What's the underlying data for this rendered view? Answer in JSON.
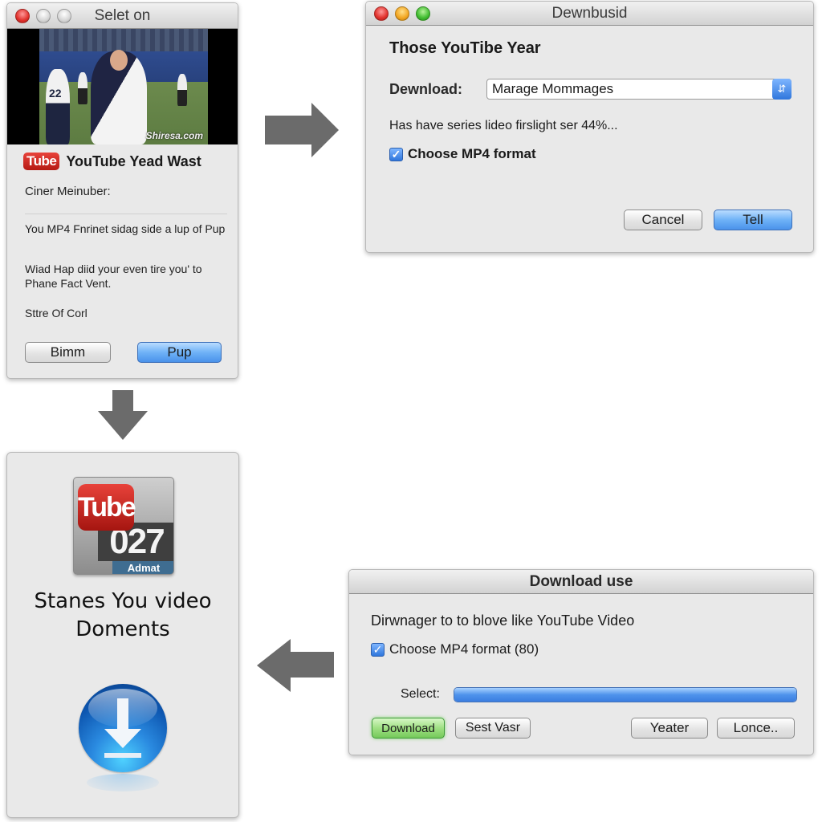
{
  "window1": {
    "title": "Selet on",
    "video": {
      "watermark": "Shiresa.com",
      "jersey_number": "22"
    },
    "badge": "Tube",
    "heading": "YouTube Yead Wast",
    "subtitle": "Ciner Meinuber:",
    "paragraph1": "You MP4 Fnrinet sidag side a lup of Pup",
    "paragraph2": "Wiad Hap diid your even tire you' to Phane Fact Vent.",
    "paragraph3": "Sttre Of Corl",
    "buttons": {
      "secondary": "Bimm",
      "primary": "Pup"
    }
  },
  "window2": {
    "title": "Dewnbusid",
    "heading": "Those YouTibe Year",
    "download_label": "Dewnload:",
    "download_select_value": "Marage Mommages",
    "status": "Has have series lideo firslight ser 44%...",
    "checkbox": {
      "label": "Choose MP4 format",
      "checked": true
    },
    "buttons": {
      "cancel": "Cancel",
      "confirm": "Tell"
    }
  },
  "window3": {
    "app_icon": {
      "badge": "Tube",
      "number": "027",
      "label": "Admat"
    },
    "caption_line1": "Stanes You video",
    "caption_line2": "Doments",
    "download_icon": "download-arrow-icon"
  },
  "window4": {
    "title": "Download use",
    "heading": "Dirwnager to to blove like YouTube Video",
    "checkbox": {
      "label": "Choose MP4 format (80)",
      "checked": true
    },
    "select_label": "Select:",
    "progress_percent": 100,
    "buttons": {
      "download": "Download",
      "sest": "Sest Vasr",
      "yeater": "Yeater",
      "lonce": "Lonce.."
    }
  },
  "arrows": [
    "right",
    "down",
    "left"
  ],
  "colors": {
    "accent_blue": "#4a92ea",
    "accent_green": "#75c95a",
    "youtube_red": "#d32a22",
    "arrow_gray": "#6b6b6b"
  }
}
